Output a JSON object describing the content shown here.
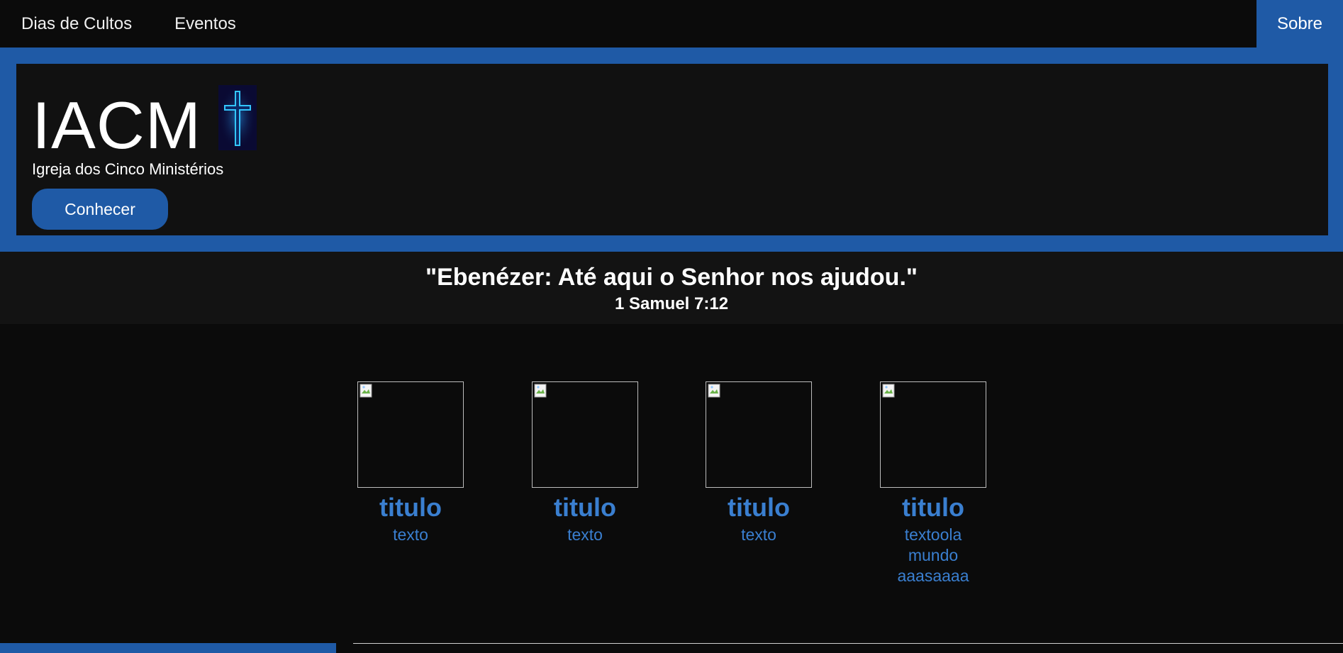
{
  "nav": {
    "items": [
      {
        "label": "Dias de Cultos"
      },
      {
        "label": "Eventos"
      }
    ],
    "right_label": "Sobre"
  },
  "hero": {
    "title": "IACM",
    "icon": "cross-icon",
    "subtitle": "Igreja dos Cinco Ministérios",
    "button_label": "Conhecer"
  },
  "verse": {
    "text": "\"Ebenézer: Até aqui o Senhor nos ajudou.\"",
    "reference": "1 Samuel 7:12"
  },
  "cards": [
    {
      "title": "titulo",
      "text": "texto"
    },
    {
      "title": "titulo",
      "text": "texto"
    },
    {
      "title": "titulo",
      "text": "texto"
    },
    {
      "title": "titulo",
      "text": "textoola mundo aaasaaaa"
    }
  ],
  "colors": {
    "accent": "#1f5aa6",
    "link": "#3a7fd0",
    "background": "#0b0b0b"
  }
}
